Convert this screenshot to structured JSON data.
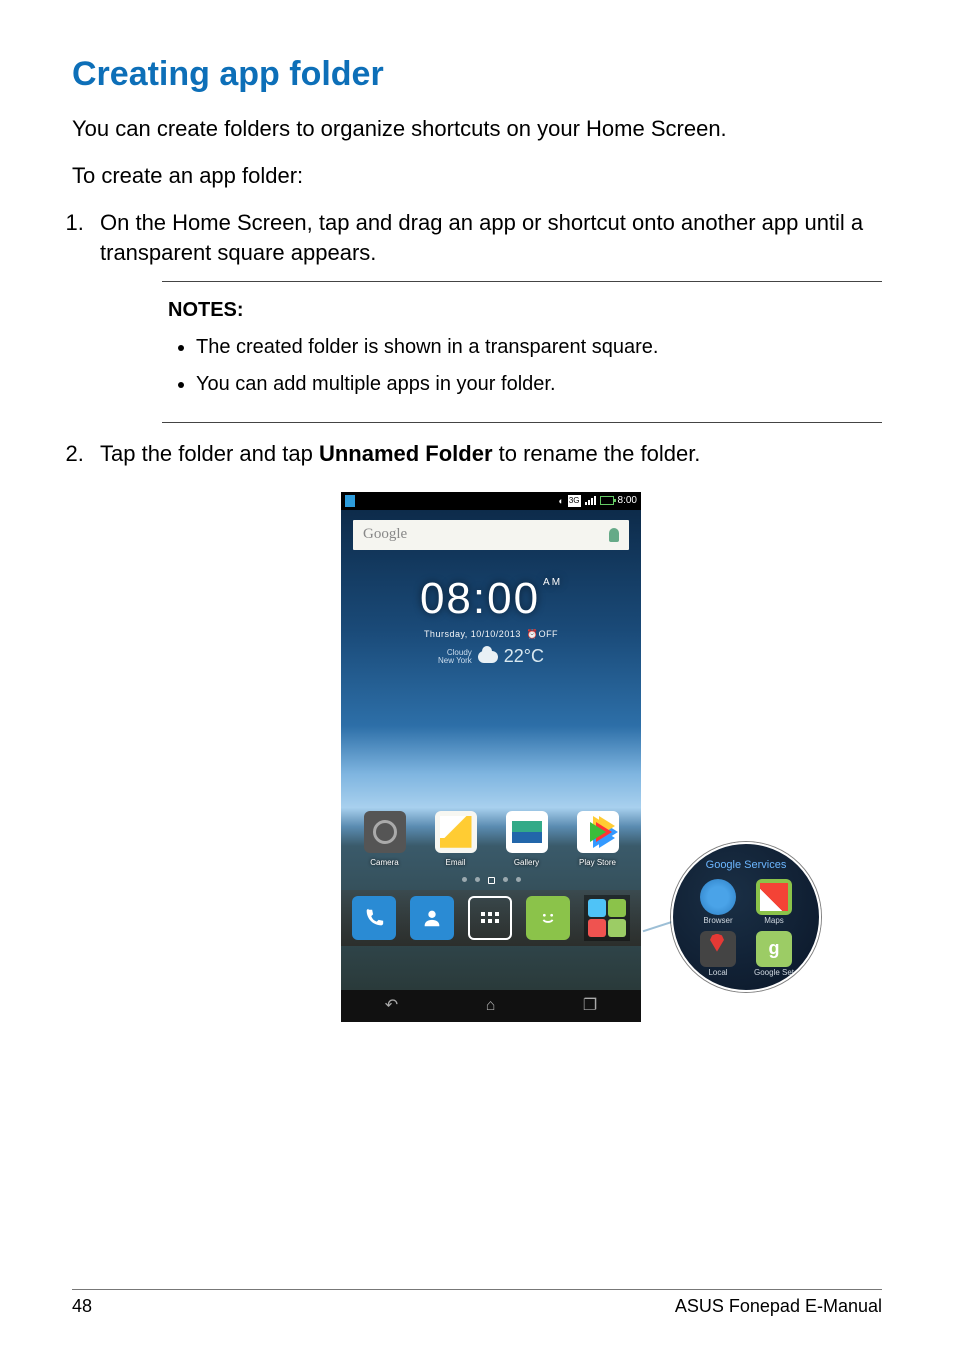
{
  "title": "Creating app folder",
  "intro1": "You can create folders to organize shortcuts on your Home Screen.",
  "intro2": "To create an app folder:",
  "steps": {
    "s1": "On the Home Screen, tap and drag an app or shortcut onto another app until a transparent square appears.",
    "s2a": "Tap the folder and tap ",
    "s2b": "Unnamed Folder",
    "s2c": " to rename the folder."
  },
  "notes": {
    "heading": "NOTES:",
    "n1": "The created folder is shown in a transparent square.",
    "n2": "You can add multiple apps in your folder."
  },
  "phone": {
    "status": {
      "threeg": "3G",
      "time": "8:00"
    },
    "search": {
      "brand": "Google"
    },
    "clock": {
      "time": "08:00",
      "ampm": "AM",
      "date": "Thursday, 10/10/2013",
      "alarm": "OFF"
    },
    "weather": {
      "cond": "Cloudy",
      "city": "New York",
      "temp": "22°C"
    },
    "apps": {
      "camera": "Camera",
      "email": "Email",
      "gallery": "Gallery",
      "play": "Play Store"
    },
    "callout": {
      "title": "Google Services",
      "browser": "Browser",
      "maps": "Maps",
      "local": "Local",
      "gset": "Google Set"
    }
  },
  "footer": {
    "page": "48",
    "book": "ASUS Fonepad E-Manual"
  }
}
